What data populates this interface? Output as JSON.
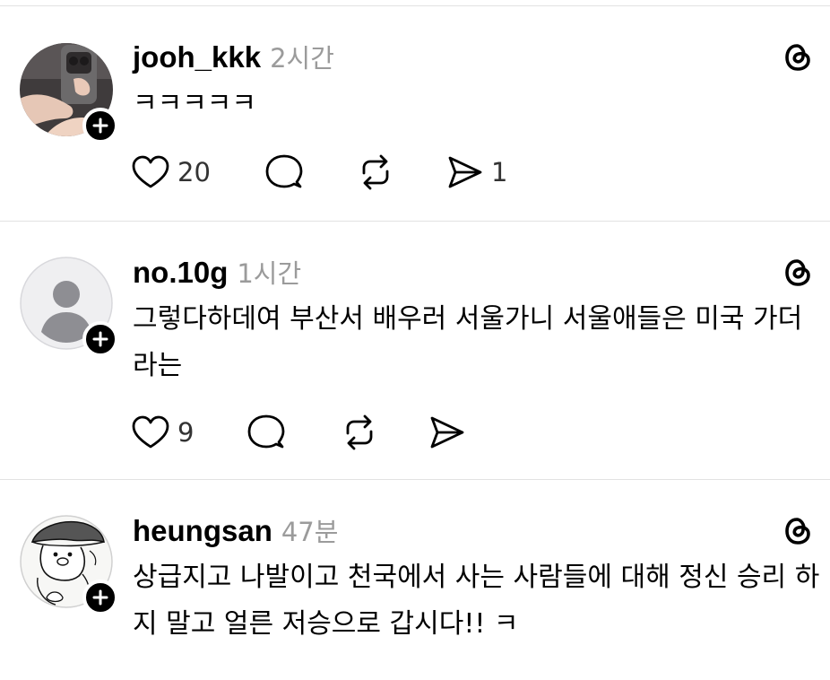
{
  "posts": [
    {
      "username": "jooh_kkk",
      "time": "2시간",
      "text": "ㅋㅋㅋㅋㅋ",
      "likes": "20",
      "comments": "",
      "reposts": "",
      "shares": "1"
    },
    {
      "username": "no.10g",
      "time": "1시간",
      "text": "그렇다하데여 부산서 배우러 서울가니 서울애들은 미국 가더라는",
      "likes": "9",
      "comments": "",
      "reposts": "",
      "shares": ""
    },
    {
      "username": "heungsan",
      "time": "47분",
      "text": "상급지고 나발이고 천국에서 사는 사람들에 대해 정신 승리 하지 말고 얼른 저승으로 갑시다!! ㅋ"
    }
  ],
  "icons": {
    "like": "heart-icon",
    "comment": "comment-icon",
    "repost": "repost-icon",
    "share": "share-icon",
    "threads": "threads-logo-icon",
    "follow": "plus-icon"
  },
  "colors": {
    "text": "#000000",
    "muted": "#9b9b9b",
    "divider": "#e2e2e2",
    "badge": "#000000"
  }
}
